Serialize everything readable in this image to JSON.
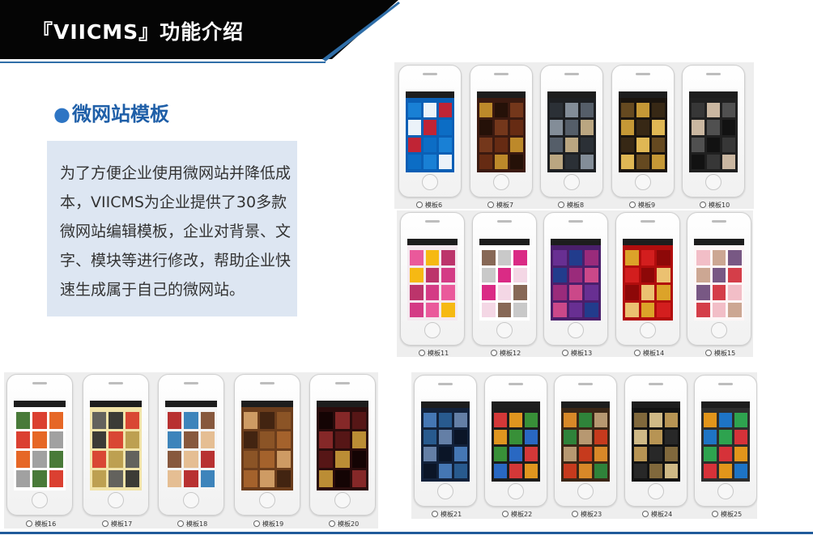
{
  "banner": {
    "title": "『VIICMS』功能介绍"
  },
  "section": {
    "bullet": "●",
    "heading": "微网站模板",
    "description": "为了方便企业使用微网站并降低成本，VIICMS为企业提供了30多款微网站编辑模板，企业对背景、文字、模块等进行修改，帮助企业快速生成属于自己的微网站。"
  },
  "templates": [
    {
      "label": "模板6",
      "theme": "blue-tiles"
    },
    {
      "label": "模板7",
      "theme": "watch-brown"
    },
    {
      "label": "模板8",
      "theme": "movie-dark"
    },
    {
      "label": "模板9",
      "theme": "gold-dark"
    },
    {
      "label": "模板10",
      "theme": "portrait-dark"
    },
    {
      "label": "模板11",
      "theme": "pink-icons"
    },
    {
      "label": "模板12",
      "theme": "fashion-white"
    },
    {
      "label": "模板13",
      "theme": "purple-menu"
    },
    {
      "label": "模板14",
      "theme": "red-china"
    },
    {
      "label": "模板15",
      "theme": "beauty-white"
    },
    {
      "label": "模板16",
      "theme": "orange-white"
    },
    {
      "label": "模板17",
      "theme": "yellow-poster"
    },
    {
      "label": "模板18",
      "theme": "food-red"
    },
    {
      "label": "模板19",
      "theme": "restaurant-brown"
    },
    {
      "label": "模板20",
      "theme": "watch-red"
    },
    {
      "label": "模板21",
      "theme": "night-blue"
    },
    {
      "label": "模板22",
      "theme": "color-tiles"
    },
    {
      "label": "模板23",
      "theme": "hotel-brown"
    },
    {
      "label": "模板24",
      "theme": "property-black"
    },
    {
      "label": "模板25",
      "theme": "team-tiles"
    }
  ],
  "colors": {
    "banner_black": "#050505",
    "banner_blue_stripe": "#2f6ea8",
    "heading_blue": "#1f5fa8",
    "desc_box": "#dde6f2",
    "gallery_bg": "#eeeeee"
  }
}
